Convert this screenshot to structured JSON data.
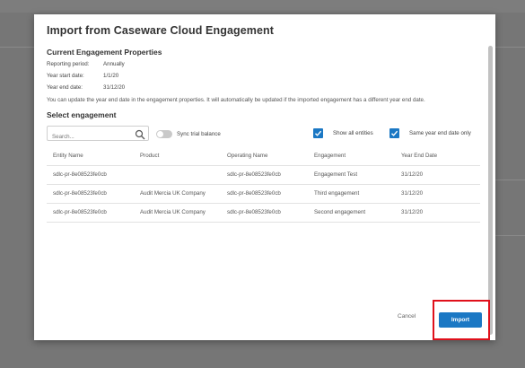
{
  "dialog": {
    "title": "Import from Caseware Cloud Engagement",
    "properties": {
      "heading": "Current Engagement Properties",
      "reporting_period_label": "Reporting period:",
      "reporting_period_value": "Annually",
      "year_start_label": "Year start date:",
      "year_start_value": "1/1/20",
      "year_end_label": "Year end date:",
      "year_end_value": "31/12/20",
      "note": "You can update the year end date in the engagement properties. It will automatically be updated if the imported engagement has a different year end date."
    },
    "select": {
      "heading": "Select engagement",
      "search_placeholder": "Search...",
      "sync_label": "Sync trial balance",
      "sync_on": false,
      "show_all_label": "Show all entities",
      "show_all_checked": true,
      "same_year_label": "Same year end date only",
      "same_year_checked": true
    },
    "table": {
      "headers": [
        "Entity Name",
        "Product",
        "Operating Name",
        "Engagement",
        "Year End Date"
      ],
      "rows": [
        [
          "sdlc-pr-8e08523fe0cb",
          "",
          "sdlc-pr-8e08523fe0cb",
          "Engagement Test",
          "31/12/20"
        ],
        [
          "sdlc-pr-8e08523fe0cb",
          "Audit Mercia UK Company",
          "sdlc-pr-8e08523fe0cb",
          "Third engagement",
          "31/12/20"
        ],
        [
          "sdlc-pr-8e08523fe0cb",
          "Audit Mercia UK Company",
          "sdlc-pr-8e08523fe0cb",
          "Second engagement",
          "31/12/20"
        ]
      ]
    },
    "buttons": {
      "cancel": "Cancel",
      "import": "Import"
    }
  },
  "colors": {
    "accent": "#1b78c4",
    "highlight": "#e0101b",
    "overlay": "#767676"
  }
}
